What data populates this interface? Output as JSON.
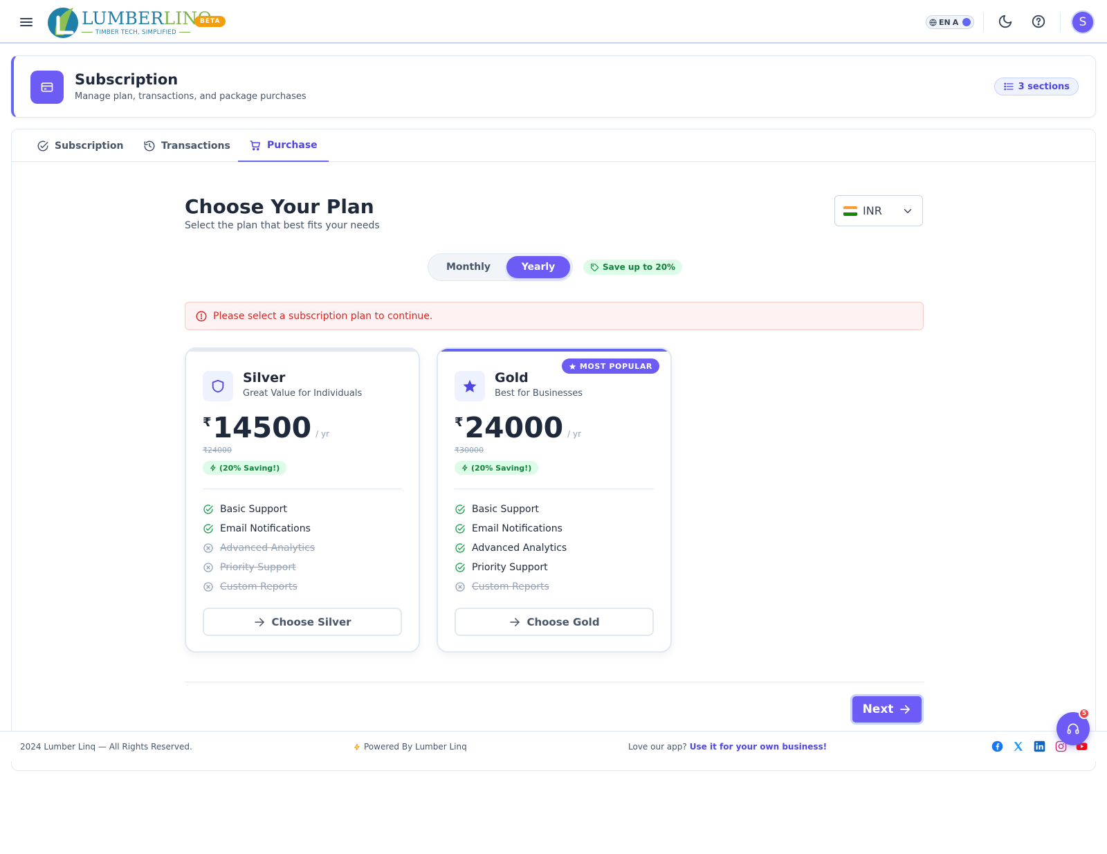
{
  "app": {
    "logo_name_part1": "LUMBER",
    "logo_name_part2": "LINQ",
    "logo_tagline": "TIMBER TECH, SIMPLIFIED",
    "beta_label": "BETA",
    "lang_label": "EN",
    "lang_alt": "A",
    "avatar_initial": "S"
  },
  "page_header": {
    "title": "Subscription",
    "subtitle": "Manage plan, transactions, and package purchases",
    "sections_badge": "3 sections"
  },
  "tabs": [
    {
      "label": "Subscription",
      "icon": "check-circle-icon",
      "active": false
    },
    {
      "label": "Transactions",
      "icon": "history-icon",
      "active": false
    },
    {
      "label": "Purchase",
      "icon": "cart-icon",
      "active": true
    }
  ],
  "purchase": {
    "title": "Choose Your Plan",
    "subtitle": "Select the plan that best fits your needs",
    "currency": {
      "selected": "INR"
    },
    "billing": {
      "monthly_label": "Monthly",
      "yearly_label": "Yearly",
      "selected": "Yearly"
    },
    "save_badge": "Save up to 20%",
    "alert": "Please select a subscription plan to continue.",
    "next_label": "Next"
  },
  "plans": [
    {
      "name": "Silver",
      "description": "Great Value for Individuals",
      "currency_symbol": "₹",
      "price": "14500",
      "period": "/ yr",
      "old_price": "₹24000",
      "saving": "(20% Saving!)",
      "icon": "shield-icon",
      "features": [
        {
          "label": "Basic Support",
          "included": true
        },
        {
          "label": "Email Notifications",
          "included": true
        },
        {
          "label": "Advanced Analytics",
          "included": false
        },
        {
          "label": "Priority Support",
          "included": false
        },
        {
          "label": "Custom Reports",
          "included": false
        }
      ],
      "button_label": "Choose Silver"
    },
    {
      "name": "Gold",
      "description": "Best for Businesses",
      "currency_symbol": "₹",
      "price": "24000",
      "period": "/ yr",
      "old_price": "₹30000",
      "saving": "(20% Saving!)",
      "icon": "star-icon",
      "popular_label": "MOST POPULAR",
      "features": [
        {
          "label": "Basic Support",
          "included": true
        },
        {
          "label": "Email Notifications",
          "included": true
        },
        {
          "label": "Advanced Analytics",
          "included": true
        },
        {
          "label": "Priority Support",
          "included": true
        },
        {
          "label": "Custom Reports",
          "included": false
        }
      ],
      "button_label": "Choose Gold"
    }
  ],
  "footer": {
    "copyright": "2024 Lumber Linq — All Rights Reserved.",
    "powered": "Powered By Lumber Linq",
    "love_text": "Love our app?",
    "love_link": "Use it for your own business!"
  },
  "support": {
    "badge_count": "5"
  },
  "colors": {
    "accent": "#6d5bf5",
    "success": "#16a34a",
    "danger": "#dc2626",
    "beta": "#f59e0b"
  }
}
